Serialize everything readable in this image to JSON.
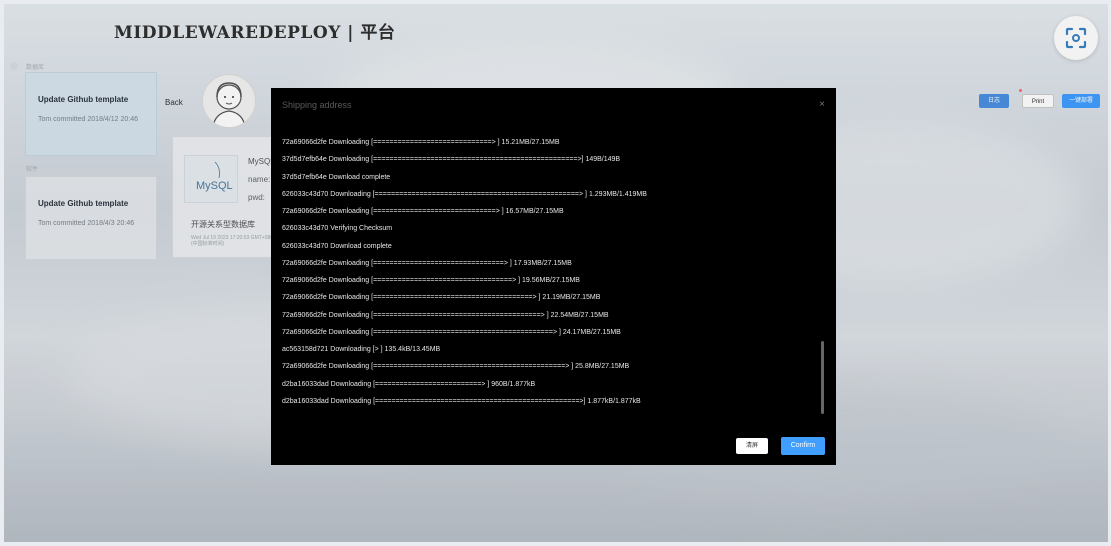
{
  "header": {
    "title": "MIDDLEWAREDEPLOY | 平台"
  },
  "sidebar": {
    "section1_label": "数据库",
    "section2_label": "软件",
    "cards": [
      {
        "title": "Update Github template",
        "subtitle": "Tom committed 2018/4/12 20:46"
      },
      {
        "title": "Update Github template",
        "subtitle": "Tom committed 2018/4/3 20:46"
      }
    ]
  },
  "detail": {
    "back_label": "Back",
    "mysql": {
      "logo_text": "MySQL",
      "name_heading": "MySQL",
      "name_label": "name:",
      "pwd_label": "pwd:",
      "description": "开源关系型数据库",
      "timestamp": "Wed Jul 19 2023 17:20:53 GMT+0800 (中国标准时间)"
    }
  },
  "toolbar": {
    "log_label": "日志",
    "print_label": "Print",
    "deploy_label": "一键部署"
  },
  "modal": {
    "title": "Shipping address",
    "close_icon": "×",
    "log_lines": [
      "72a69066d2fe Downloading [=============================>  ] 15.21MB/27.15MB",
      "37d5d7efb64e Downloading [==================================================>] 149B/149B",
      "37d5d7efb64e Download complete",
      "626033c43d70 Downloading [==================================================> ] 1.293MB/1.419MB",
      "72a69066d2fe Downloading [==============================>  ] 16.57MB/27.15MB",
      "626033c43d70 Verifying Checksum",
      "626033c43d70 Download complete",
      "72a69066d2fe Downloading [================================> ] 17.93MB/27.15MB",
      "72a69066d2fe Downloading [==================================> ] 19.56MB/27.15MB",
      "72a69066d2fe Downloading [=======================================> ] 21.19MB/27.15MB",
      "72a69066d2fe Downloading [=========================================> ] 22.54MB/27.15MB",
      "72a69066d2fe Downloading [============================================> ] 24.17MB/27.15MB",
      "ac563158d721 Downloading [> ] 135.4kB/13.45MB",
      "72a69066d2fe Downloading [===============================================> ] 25.8MB/27.15MB",
      "d2ba16033dad Downloading [==========================> ] 960B/1.877kB",
      "d2ba16033dad Downloading [==================================================>] 1.877kB/1.877kB"
    ],
    "clear_label": "清屏",
    "confirm_label": "Confirm"
  },
  "colors": {
    "accent": "#409eff",
    "modal_bg": "#000000"
  }
}
